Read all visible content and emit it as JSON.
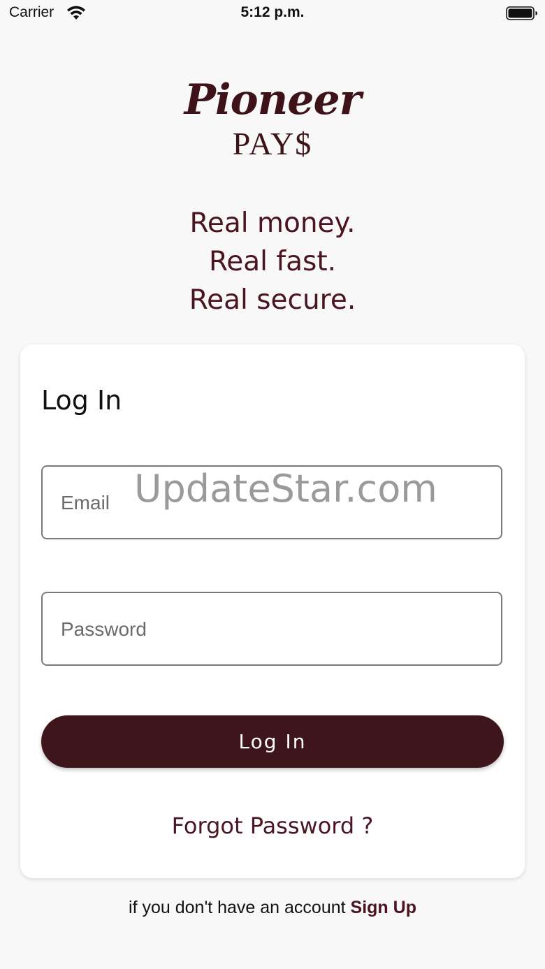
{
  "status_bar": {
    "carrier": "Carrier",
    "time": "5:12 p.m.",
    "wifi_icon": "wifi-icon",
    "battery_icon": "battery-full-icon"
  },
  "logo": {
    "line1": "Pioneer",
    "line2": "PAY$"
  },
  "tagline": {
    "line1": "Real money.",
    "line2": "Real fast.",
    "line3": "Real secure."
  },
  "login_card": {
    "title": "Log In",
    "email_placeholder": "Email",
    "password_placeholder": "Password",
    "login_button_label": "Log In",
    "forgot_password_label": "Forgot Password ?"
  },
  "footer": {
    "prompt_text": "if you don't have an account",
    "signup_label": "Sign Up"
  },
  "watermark": "UpdateStar.com",
  "colors": {
    "brand": "#3f151c",
    "accent_text": "#4a1520",
    "background": "#f8f8f8",
    "card": "#ffffff"
  }
}
